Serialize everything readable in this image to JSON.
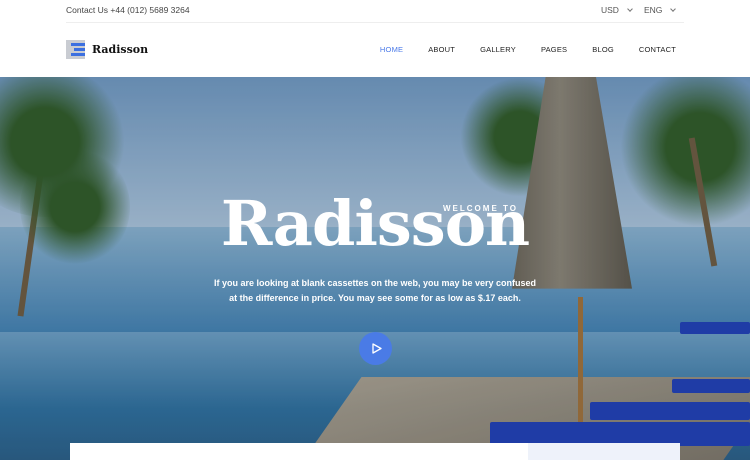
{
  "topbar": {
    "contact": "Contact Us +44 (012) 5689 3264",
    "currency": "USD",
    "language": "ENG"
  },
  "brand": {
    "name": "Radisson"
  },
  "nav": {
    "items": [
      {
        "label": "HOME",
        "active": true
      },
      {
        "label": "ABOUT",
        "active": false
      },
      {
        "label": "GALLERY",
        "active": false
      },
      {
        "label": "PAGES",
        "active": false
      },
      {
        "label": "BLOG",
        "active": false
      },
      {
        "label": "CONTACT",
        "active": false
      }
    ]
  },
  "hero": {
    "eyebrow": "WELCOME TO",
    "title": "Radisson",
    "subtitle": "If you are looking at blank cassettes on the web, you may be very confused at the difference in price. You may see some for as low as $.17 each.",
    "play_icon": "play-icon"
  },
  "colors": {
    "accent": "#4a79e8",
    "play_button": "#4a7be6"
  }
}
